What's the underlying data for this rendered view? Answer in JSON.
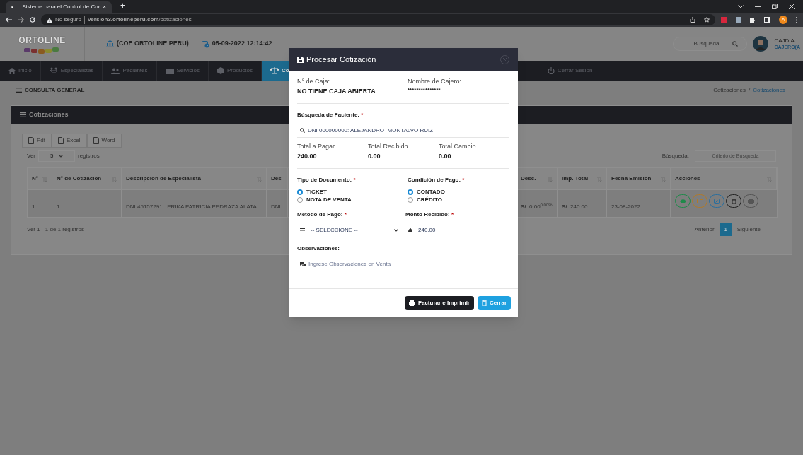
{
  "browser": {
    "tab_title": ".:: Sistema para el Control de Cor",
    "tab_close": "×",
    "new_tab": "+",
    "security": "No seguro",
    "url": "**version3.ortolineperu.com**/cotizaciones",
    "profile": "A"
  },
  "header": {
    "logo": "ORTOLINE",
    "company": "(COE ORTOLINE PERU)",
    "datetime": "08-09-2022 12:14:42",
    "search": {
      "placeholder": "Búsqueda..."
    },
    "user": {
      "name": "CAJDIA",
      "role": "CAJERO(A"
    }
  },
  "nav": [
    {
      "label": "Inicio",
      "kind": "home",
      "selected": false
    },
    {
      "label": "Especialistas",
      "kind": "arrows",
      "selected": false
    },
    {
      "label": "Pacientes",
      "kind": "users",
      "selected": false
    },
    {
      "label": "Servicios",
      "kind": "folder",
      "selected": false
    },
    {
      "label": "Productos",
      "kind": "box",
      "selected": false
    },
    {
      "label": "Co",
      "kind": "scale",
      "selected": true
    },
    {
      "label": "Cerrar Sesión",
      "kind": "power",
      "selected": false
    }
  ],
  "page_title": "CONSULTA GENERAL",
  "breadcrumb": {
    "separator": "/",
    "items": [
      {
        "label": "Cotizaciones",
        "selected": false
      },
      {
        "label": "Cotizaciones",
        "selected": true
      }
    ]
  },
  "panel": {
    "title": "Cotizaciones",
    "exports": [
      "Pdf",
      "Excel",
      "Word"
    ],
    "length": {
      "before": "Ver",
      "value": "5",
      "after": "registros"
    },
    "search": {
      "label": "Búsqueda:",
      "placeholder": "Criterio de Búsqueda"
    },
    "table": {
      "columns": [
        "N°",
        "N° de Cotización",
        "Descripción de Especialista",
        "Des",
        "Desc.",
        "Imp. Total",
        "Fecha Emisión",
        "Acciones"
      ],
      "rows": [
        {
          "cells": [
            "1",
            "1",
            "DNI 45157291 : ERIKA PATRICIA PEDRAZA ALATA",
            "DNI",
            "**S/.** 0.00$^{0.00%}$",
            "**S/.** 240.00",
            "23-08-2022"
          ],
          "actions": [
            {
              "kind": "view",
              "color": "#1f8a4a"
            },
            {
              "kind": "open",
              "color": "#b07a2a"
            },
            {
              "kind": "edit",
              "color": "#2a6f9e"
            },
            {
              "kind": "delete",
              "color": "#222222"
            },
            {
              "kind": "print",
              "color": "#555555"
            }
          ]
        }
      ]
    },
    "info": "Ver 1 - 1 de 1 registros",
    "pagination": {
      "prev": "Anterior",
      "pages": [
        {
          "label": "1",
          "selected": true
        }
      ],
      "next": "Siguiente"
    }
  },
  "modal": {
    "title": "Procesar Cotización",
    "caja": {
      "label": "N° de Caja:",
      "value": "NO TIENE CAJA ABIERTA"
    },
    "cajero": {
      "label": "Nombre de Cajero:",
      "value": "***************"
    },
    "patient": {
      "label": "Búsqueda de Paciente:",
      "required": "*",
      "value": "DNI 000000000: ALEJANDRO  MONTALVO RUIZ"
    },
    "totals": [
      {
        "label": "Total a Pagar",
        "value": "240.00"
      },
      {
        "label": "Total Recibido",
        "value": "0.00"
      },
      {
        "label": "Total Cambio",
        "value": "0.00"
      }
    ],
    "radio_groups": [
      {
        "label": "Tipo de Documento:",
        "required": "*",
        "options": [
          {
            "label": "TICKET",
            "selected": true
          },
          {
            "label": "NOTA DE VENTA",
            "selected": false
          }
        ]
      },
      {
        "label": "Condición de Pago:",
        "required": "*",
        "options": [
          {
            "label": "CONTADO",
            "selected": true
          },
          {
            "label": "CRÉDITO",
            "selected": false
          }
        ]
      }
    ],
    "payment_method": {
      "label": "Método de Pago:",
      "required": "*",
      "value": "-- SELECCIONE --"
    },
    "amount": {
      "label": "Monto Recibido:",
      "required": "*",
      "value": "240.00"
    },
    "notes": {
      "label": "Observaciones:",
      "placeholder": "Ingrese Observaciones en Venta"
    },
    "buttons": [
      {
        "label": "Facturar e Imprimir",
        "kind": "print"
      },
      {
        "label": "Cerrar",
        "kind": "close"
      }
    ]
  }
}
